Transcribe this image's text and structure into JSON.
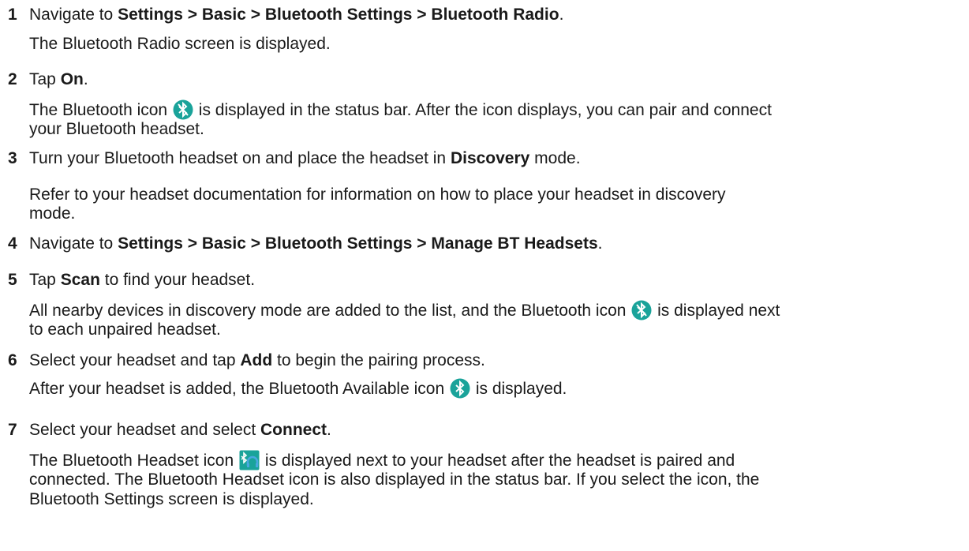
{
  "steps": [
    {
      "num": "1",
      "instr_pre": "Navigate to ",
      "instr_bold": "Settings > Basic > Bluetooth Settings > Bluetooth Radio",
      "instr_post": ".",
      "result": "The Bluetooth Radio screen is displayed."
    },
    {
      "num": "2",
      "instr_pre": "Tap ",
      "instr_bold": "On",
      "instr_post": ".",
      "result_pre": "The Bluetooth icon",
      "result_post_l1": " is displayed in the status bar. After the icon displays, you can pair and connect",
      "result_l2": "your Bluetooth headset."
    },
    {
      "num": "3",
      "instr_pre": "Turn your Bluetooth headset on and place the headset in ",
      "instr_bold": "Discovery",
      "instr_post": " mode.",
      "result_l1": "Refer to your headset documentation for information on how to place your headset in discovery",
      "result_l2": "mode."
    },
    {
      "num": "4",
      "instr_pre": "Navigate to ",
      "instr_bold": "Settings > Basic > Bluetooth Settings > Manage BT Headsets",
      "instr_post": "."
    },
    {
      "num": "5",
      "instr_pre": "Tap ",
      "instr_bold": "Scan",
      "instr_post": " to find your headset.",
      "result_pre": "All nearby devices in discovery mode are added to the list, and the Bluetooth icon",
      "result_post_l1": " is displayed next",
      "result_l2": "to each unpaired headset."
    },
    {
      "num": "6",
      "instr_pre": "Select your headset and tap ",
      "instr_bold": "Add",
      "instr_post": " to begin the pairing process.",
      "result_pre": "After your headset is added, the Bluetooth Available icon",
      "result_post_l1": " is displayed."
    },
    {
      "num": "7",
      "instr_pre": "Select your headset and select ",
      "instr_bold": "Connect",
      "instr_post": ".",
      "result_pre": "The Bluetooth Headset icon",
      "result_post_l1": " is displayed next to your headset after the headset is paired and",
      "result_l2": "connected. The Bluetooth Headset icon is also displayed in the status bar. If you select the icon, the",
      "result_l3": "Bluetooth Settings screen is displayed."
    }
  ],
  "icons": {
    "bluetooth_off": "bluetooth-off-icon",
    "bluetooth_available": "bluetooth-available-icon",
    "bluetooth_headset": "bluetooth-headset-icon",
    "teal": "#1aa39a",
    "headset_blue": "#4aa8e0"
  }
}
